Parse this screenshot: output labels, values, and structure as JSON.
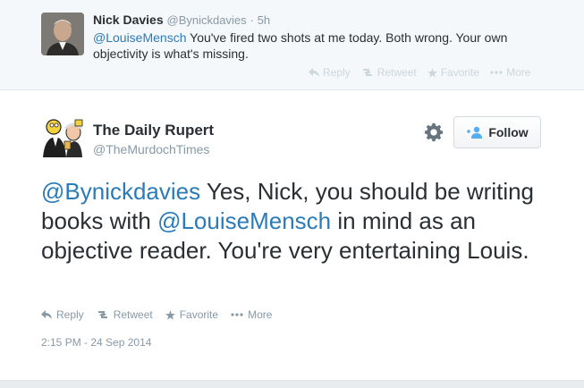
{
  "reply_tweet": {
    "name": "Nick Davies",
    "handle": "@Bynickdavies",
    "separator": "·",
    "time": "5h",
    "mention": "@LouiseMensch",
    "text": " You've fired two shots at me today. Both wrong. Your own objectivity is what's missing.",
    "actions": {
      "reply": "Reply",
      "retweet": "Retweet",
      "favorite": "Favorite",
      "more": "More"
    }
  },
  "main_tweet": {
    "name": "The Daily Rupert",
    "handle": "@TheMurdochTimes",
    "follow_label": "Follow",
    "text_parts": {
      "mention1": "@Bynickdavies",
      "text1": " Yes, Nick, you should be writing books with ",
      "mention2": "@LouiseMensch",
      "text2": " in mind as an objective reader. You're very entertaining Louis."
    },
    "actions": {
      "reply": "Reply",
      "retweet": "Retweet",
      "favorite": "Favorite",
      "more": "More"
    },
    "timestamp": "2:15 PM - 24 Sep 2014"
  },
  "colors": {
    "link": "#2b7bb9",
    "muted": "#8899a6",
    "faint_actions": "#ccd6dd",
    "text": "#292f33",
    "top_background": "#f5f8fa"
  },
  "icons": [
    "reply-icon",
    "retweet-icon",
    "star-icon",
    "more-dots-icon",
    "gear-icon",
    "person-plus-icon"
  ]
}
